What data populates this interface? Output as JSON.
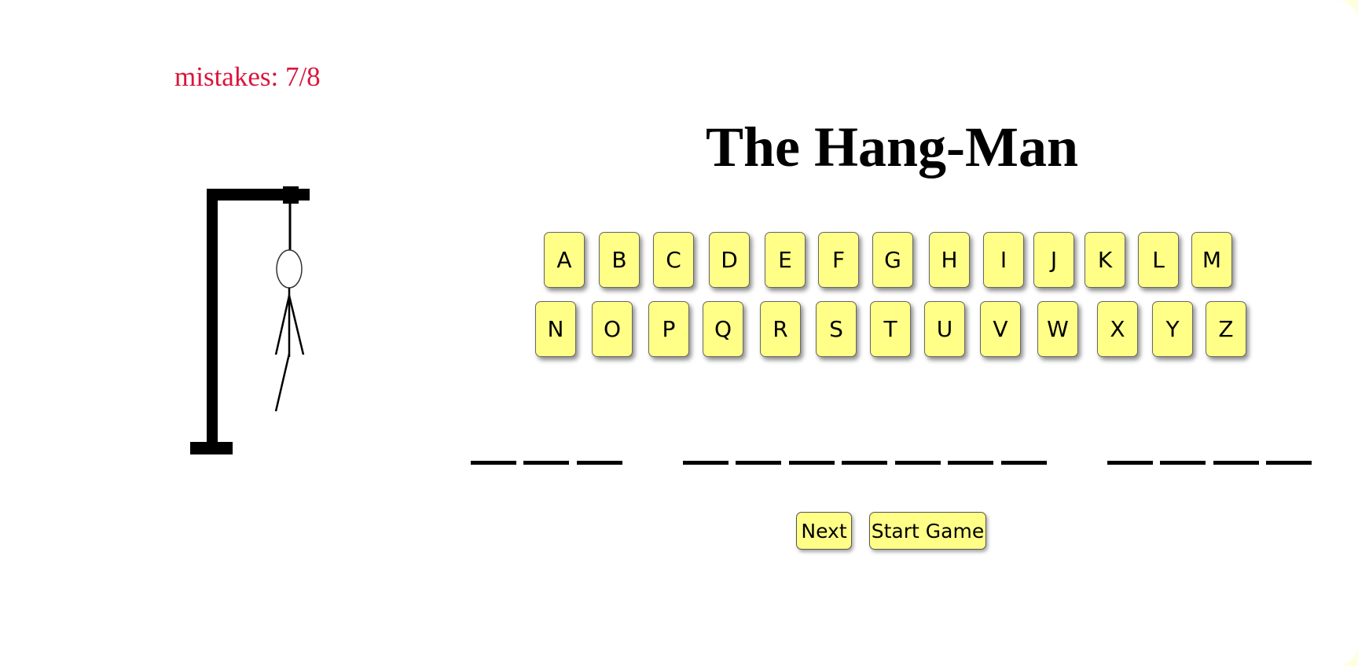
{
  "status": {
    "mistakes_label": "mistakes: 7/8",
    "mistakes_color": "#dc143c"
  },
  "title": "The Hang-Man",
  "keyboard": {
    "key_color": "#ffff88",
    "row1": [
      "A",
      "B",
      "C",
      "D",
      "E",
      "F",
      "G",
      "H",
      "I",
      "J",
      "K",
      "L",
      "M"
    ],
    "row2": [
      "N",
      "O",
      "P",
      "Q",
      "R",
      "S",
      "T",
      "U",
      "V",
      "W",
      "X",
      "Y",
      "Z"
    ]
  },
  "puzzle": {
    "word_lengths": [
      3,
      7,
      4
    ],
    "revealed": [
      "",
      "",
      "",
      "",
      "",
      "",
      "",
      "",
      "",
      "",
      "",
      "",
      "",
      ""
    ]
  },
  "controls": {
    "next_label": "Next",
    "start_label": "Start Game"
  },
  "hangman": {
    "parts_drawn": [
      "gallows",
      "rope",
      "head",
      "body",
      "left-arm",
      "right-arm",
      "left-leg"
    ]
  }
}
